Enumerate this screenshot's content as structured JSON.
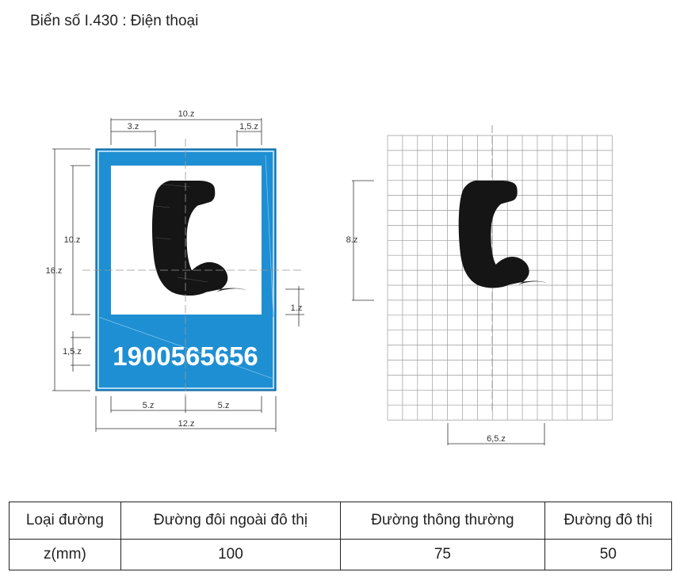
{
  "title": "Biển số I.430 : Điện thoại",
  "sign": {
    "phone_number": "1900565656",
    "background_color": "#1e8fd3",
    "panel_color": "#ffffff",
    "icon": "telephone-handset-icon"
  },
  "dimensions": {
    "top_width": "10.z",
    "top_left_offset": "3.z",
    "top_right_offset": "1,5.z",
    "left_total_height": "16.z",
    "left_panel_height": "10.z",
    "left_number_height": "1,5.z",
    "right_gap": "1.z",
    "bottom_left_half": "5.z",
    "bottom_right_half": "5.z",
    "bottom_total_width": "12.z",
    "grid_icon_height": "8.z",
    "grid_icon_width": "6,5.z"
  },
  "table": {
    "headers": [
      "Loại đường",
      "Đường đôi ngoài đô thị",
      "Đường thông thường",
      "Đường đô thị"
    ],
    "rows": [
      [
        "z(mm)",
        "100",
        "75",
        "50"
      ]
    ]
  }
}
